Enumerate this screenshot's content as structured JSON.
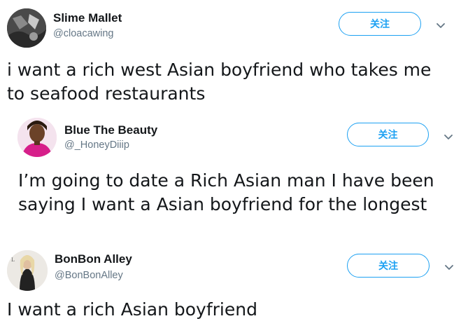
{
  "tweets": [
    {
      "name": "Slime Mallet",
      "handle": "@cloacawing",
      "follow_label": "关注",
      "avatar_icon": "user-avatar-icon",
      "text": "i want a rich west Asian boyfriend who takes me to seafood restaurants"
    },
    {
      "name": "Blue The Beauty",
      "handle": "@_HoneyDiiip",
      "follow_label": "关注",
      "avatar_icon": "user-avatar-icon",
      "text": "I’m going to date a Rich Asian man I have been saying I want a Asian boyfriend for the longest"
    },
    {
      "name": "BonBon Alley",
      "handle": "@BonBonAlley",
      "follow_label": "关注",
      "avatar_icon": "user-avatar-icon",
      "text": "I want a rich Asian boyfriend"
    }
  ],
  "colors": {
    "accent": "#1da1f2",
    "secondary_text": "#657786",
    "primary_text": "#14171a"
  },
  "icons": {
    "more": "chevron-down-icon"
  }
}
